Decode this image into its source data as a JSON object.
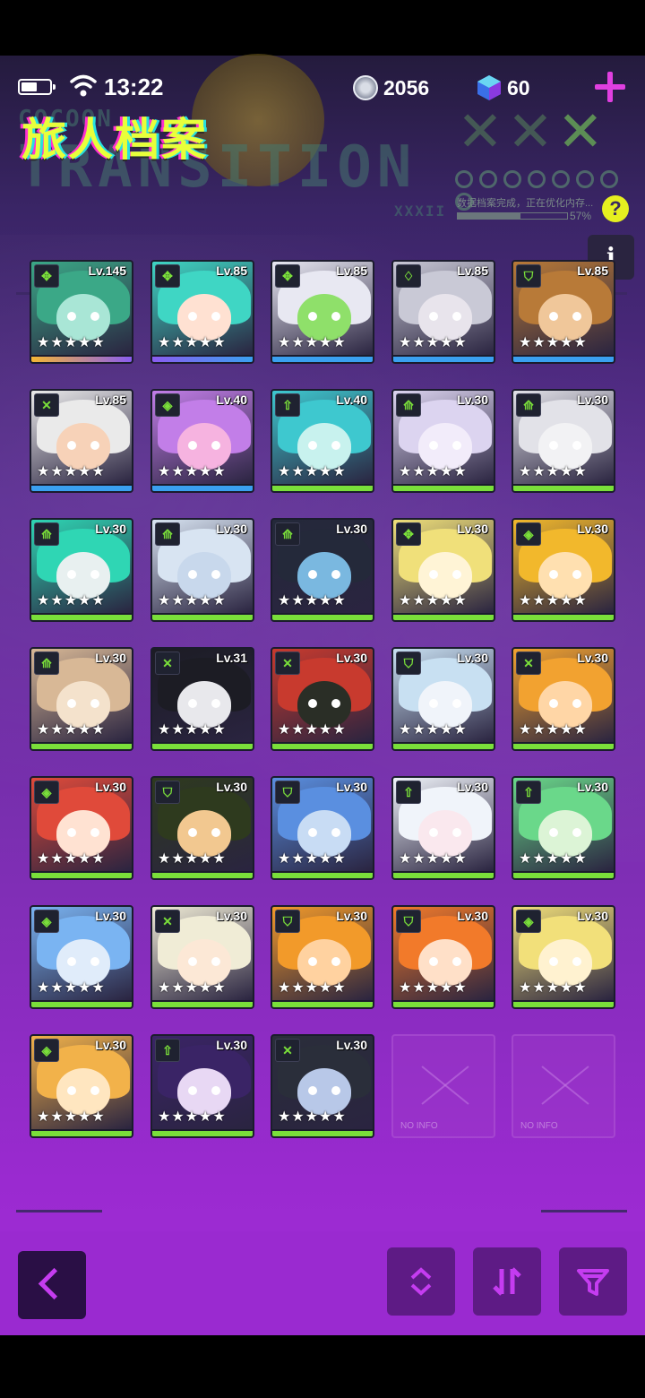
{
  "status": {
    "time": "13:22",
    "coins": "2056",
    "gems": "60"
  },
  "header": {
    "title": "旅人档案",
    "deco_top": "COCOON",
    "deco_big": "TRANSITION",
    "deco_sub": "XXXII",
    "load_text": "数据档案完成，正在优化内存...",
    "load_pct": "57%",
    "help": "?",
    "info": "i"
  },
  "colors": {
    "accent": "#e03fe0",
    "title": "#e8ff3a",
    "rarity_gold": "#f4b634",
    "rarity_purple": "#8a5cf0",
    "rarity_blue": "#3aa0f0",
    "rarity_green": "#7adf3a"
  },
  "cards": [
    {
      "level": "Lv.145",
      "icon": "crossed-arrows-icon",
      "stars": "★★★★★",
      "rarity": "gold",
      "hair": "#3ba887",
      "skin": "#a9e6d6"
    },
    {
      "level": "Lv.85",
      "icon": "crossed-arrows-icon",
      "stars": "★★★★★",
      "rarity": "purple",
      "hair": "#3fd6c4",
      "skin": "#ffe1d2"
    },
    {
      "level": "Lv.85",
      "icon": "crossed-arrows-icon",
      "stars": "★★★★★",
      "rarity": "blue",
      "hair": "#e8e8f2",
      "skin": "#8fe06a"
    },
    {
      "level": "Lv.85",
      "icon": "bow-icon",
      "stars": "★★★★★",
      "rarity": "blue",
      "hair": "#c9c9d6",
      "skin": "#e8e4ec"
    },
    {
      "level": "Lv.85",
      "icon": "shield-icon",
      "stars": "★★★★★",
      "rarity": "blue",
      "hair": "#b87a38",
      "skin": "#f0c79a"
    },
    {
      "level": "Lv.85",
      "icon": "cross-sword-icon",
      "stars": "★★★★★",
      "rarity": "blue",
      "hair": "#eaeaea",
      "skin": "#f7d2b8"
    },
    {
      "level": "Lv.40",
      "icon": "gem-class-icon",
      "stars": "★★★★★",
      "rarity": "blue",
      "hair": "#c27ee8",
      "skin": "#f6b3e0"
    },
    {
      "level": "Lv.40",
      "icon": "up-arrow-icon",
      "stars": "★★★★★",
      "rarity": "green",
      "hair": "#3ec8cf",
      "skin": "#c8f2ee"
    },
    {
      "level": "Lv.30",
      "icon": "spear-icon",
      "stars": "★★★★★",
      "rarity": "green",
      "hair": "#dcd4f0",
      "skin": "#f2ecfa"
    },
    {
      "level": "Lv.30",
      "icon": "spear-icon",
      "stars": "★★★★★",
      "rarity": "green",
      "hair": "#e2e2e8",
      "skin": "#f2f2f4"
    },
    {
      "level": "Lv.30",
      "icon": "spear-icon",
      "stars": "★★★★★",
      "rarity": "green",
      "hair": "#2fd6b4",
      "skin": "#e8f0f0"
    },
    {
      "level": "Lv.30",
      "icon": "spear-icon",
      "stars": "★★★★★",
      "rarity": "green",
      "hair": "#d8e4f2",
      "skin": "#c8d8ec"
    },
    {
      "level": "Lv.30",
      "icon": "spear-icon",
      "stars": "★★★★★",
      "rarity": "green",
      "hair": "#24293a",
      "skin": "#7ab8e0"
    },
    {
      "level": "Lv.30",
      "icon": "crossed-arrows-icon",
      "stars": "★★★★★",
      "rarity": "green",
      "hair": "#f0e07a",
      "skin": "#fff4d6"
    },
    {
      "level": "Lv.30",
      "icon": "gem-class-icon",
      "stars": "★★★★★",
      "rarity": "green",
      "hair": "#f2b82c",
      "skin": "#ffe0b0"
    },
    {
      "level": "Lv.30",
      "icon": "spear-icon",
      "stars": "★★★★★",
      "rarity": "green",
      "hair": "#d8b896",
      "skin": "#f4e2cc"
    },
    {
      "level": "Lv.31",
      "icon": "cross-sword-icon",
      "stars": "★★★★★",
      "rarity": "green",
      "hair": "#1c1c24",
      "skin": "#e8e8ec"
    },
    {
      "level": "Lv.30",
      "icon": "cross-sword-icon",
      "stars": "★★★★★",
      "rarity": "green",
      "hair": "#c83a2e",
      "skin": "#2a2e26"
    },
    {
      "level": "Lv.30",
      "icon": "shield-icon",
      "stars": "★★★★★",
      "rarity": "green",
      "hair": "#c8e0f2",
      "skin": "#f0f4fa"
    },
    {
      "level": "Lv.30",
      "icon": "cross-sword-icon",
      "stars": "★★★★★",
      "rarity": "green",
      "hair": "#f2a230",
      "skin": "#ffd6a6"
    },
    {
      "level": "Lv.30",
      "icon": "gem-class-icon",
      "stars": "★★★★★",
      "rarity": "green",
      "hair": "#e04a3a",
      "skin": "#ffe2d2"
    },
    {
      "level": "Lv.30",
      "icon": "shield-icon",
      "stars": "★★★★★",
      "rarity": "green",
      "hair": "#2e3a1e",
      "skin": "#f2c890"
    },
    {
      "level": "Lv.30",
      "icon": "shield-icon",
      "stars": "★★★★★",
      "rarity": "green",
      "hair": "#5a8fe0",
      "skin": "#c8dcf4"
    },
    {
      "level": "Lv.30",
      "icon": "up-arrow-icon",
      "stars": "★★★★★",
      "rarity": "green",
      "hair": "#f0f4fa",
      "skin": "#fae8ee"
    },
    {
      "level": "Lv.30",
      "icon": "up-arrow-icon",
      "stars": "★★★★★",
      "rarity": "green",
      "hair": "#6ad88a",
      "skin": "#dcf4d6"
    },
    {
      "level": "Lv.30",
      "icon": "gem-class-icon",
      "stars": "★★★★★",
      "rarity": "green",
      "hair": "#7ab4f2",
      "skin": "#e0ecfa"
    },
    {
      "level": "Lv.30",
      "icon": "cross-sword-icon",
      "stars": "★★★★★",
      "rarity": "green",
      "hair": "#f0ecd6",
      "skin": "#fce8d6"
    },
    {
      "level": "Lv.30",
      "icon": "shield-icon",
      "stars": "★★★★★",
      "rarity": "green",
      "hair": "#f29a2a",
      "skin": "#ffd2a0"
    },
    {
      "level": "Lv.30",
      "icon": "shield-icon",
      "stars": "★★★★★",
      "rarity": "green",
      "hair": "#f27a2a",
      "skin": "#ffe0c8"
    },
    {
      "level": "Lv.30",
      "icon": "gem-class-icon",
      "stars": "★★★★★",
      "rarity": "green",
      "hair": "#f2e07a",
      "skin": "#fff2d0"
    },
    {
      "level": "Lv.30",
      "icon": "gem-class-icon",
      "stars": "★★★★★",
      "rarity": "green",
      "hair": "#f2b24a",
      "skin": "#ffe6c0"
    },
    {
      "level": "Lv.30",
      "icon": "up-arrow-icon",
      "stars": "★★★★★",
      "rarity": "green",
      "hair": "#3a2466",
      "skin": "#e8d8f4"
    },
    {
      "level": "Lv.30",
      "icon": "cross-sword-icon",
      "stars": "★★★★★",
      "rarity": "green",
      "hair": "#2a2e3a",
      "skin": "#b8c8e8"
    }
  ],
  "empty_slots": [
    {
      "label": "NO INFO"
    },
    {
      "label": "NO INFO"
    }
  ],
  "icon_glyphs": {
    "crossed-arrows-icon": "✥",
    "bow-icon": "♢",
    "shield-icon": "⛉",
    "cross-sword-icon": "✕",
    "gem-class-icon": "◈",
    "up-arrow-icon": "⇧",
    "spear-icon": "⟰"
  }
}
